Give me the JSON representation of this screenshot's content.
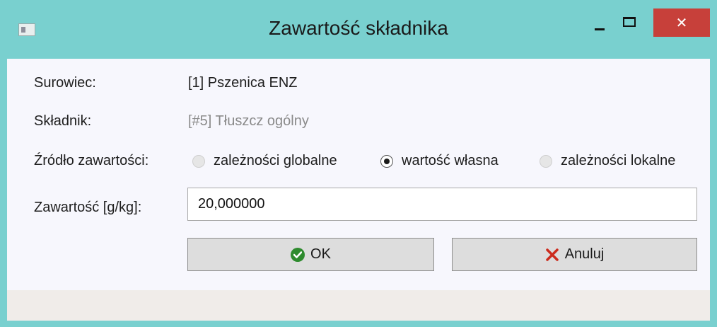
{
  "window": {
    "title": "Zawartość składnika",
    "close_glyph": "✕"
  },
  "form": {
    "surowiec_label": "Surowiec:",
    "surowiec_value": "[1] Pszenica ENZ",
    "skladnik_label": "Składnik:",
    "skladnik_value": "[#5] Tłuszcz ogólny",
    "zrodlo_label": "Źródło zawartości:",
    "zrodlo_options": [
      {
        "label": "zależności globalne",
        "selected": false
      },
      {
        "label": "wartość własna",
        "selected": true
      },
      {
        "label": "zależności lokalne",
        "selected": false
      }
    ],
    "zawartosc_label": "Zawartość [g/kg]:",
    "zawartosc_value": "20,000000"
  },
  "buttons": {
    "ok_label": "OK",
    "cancel_label": "Anuluj"
  },
  "colors": {
    "titlebar": "#79d0cf",
    "close_button": "#c7403a",
    "ok_icon": "#2e8b2e",
    "cancel_icon": "#cc2b1d"
  },
  "icons": {
    "app": "app-window-icon",
    "ok": "check-circle-icon",
    "cancel": "x-icon"
  }
}
